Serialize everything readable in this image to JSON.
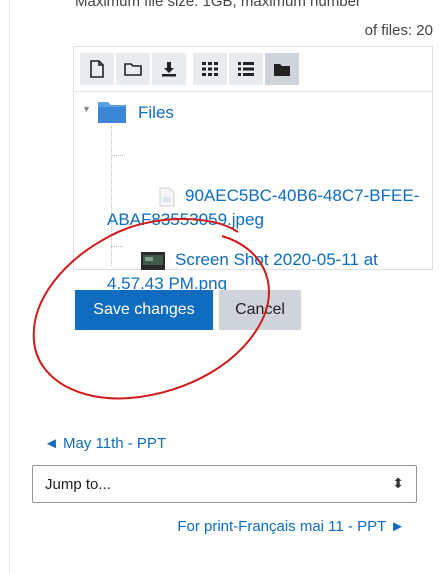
{
  "file_info": {
    "line1": "Maximum file size: 1GB, maximum number",
    "line2": "of files: 20"
  },
  "toolbar": {
    "icons": [
      "new-file-icon",
      "new-folder-icon",
      "download-icon",
      "icon-view-icon",
      "list-view-icon",
      "tree-view-icon"
    ],
    "active": "tree-view-icon"
  },
  "tree": {
    "root_label": "Files",
    "files": [
      {
        "line1": "90AEC5BC-40B6-48C7-BFEE-",
        "line2": "ABAF83553059.jpeg"
      },
      {
        "line1": "Screen Shot 2020-05-11 at",
        "line2": "4.57.43 PM.png"
      }
    ]
  },
  "buttons": {
    "save": "Save changes",
    "cancel": "Cancel"
  },
  "navigation": {
    "prev": "◄ May 11th - PPT",
    "jump_placeholder": "Jump to...",
    "jump_caret": "⬍",
    "next": "For print-Français mai 11 - PPT ►"
  },
  "colors": {
    "link": "#0f6cbf",
    "primary_button": "#0f6cbf",
    "secondary_button": "#ced4da",
    "annotation": "#d11a1a"
  }
}
